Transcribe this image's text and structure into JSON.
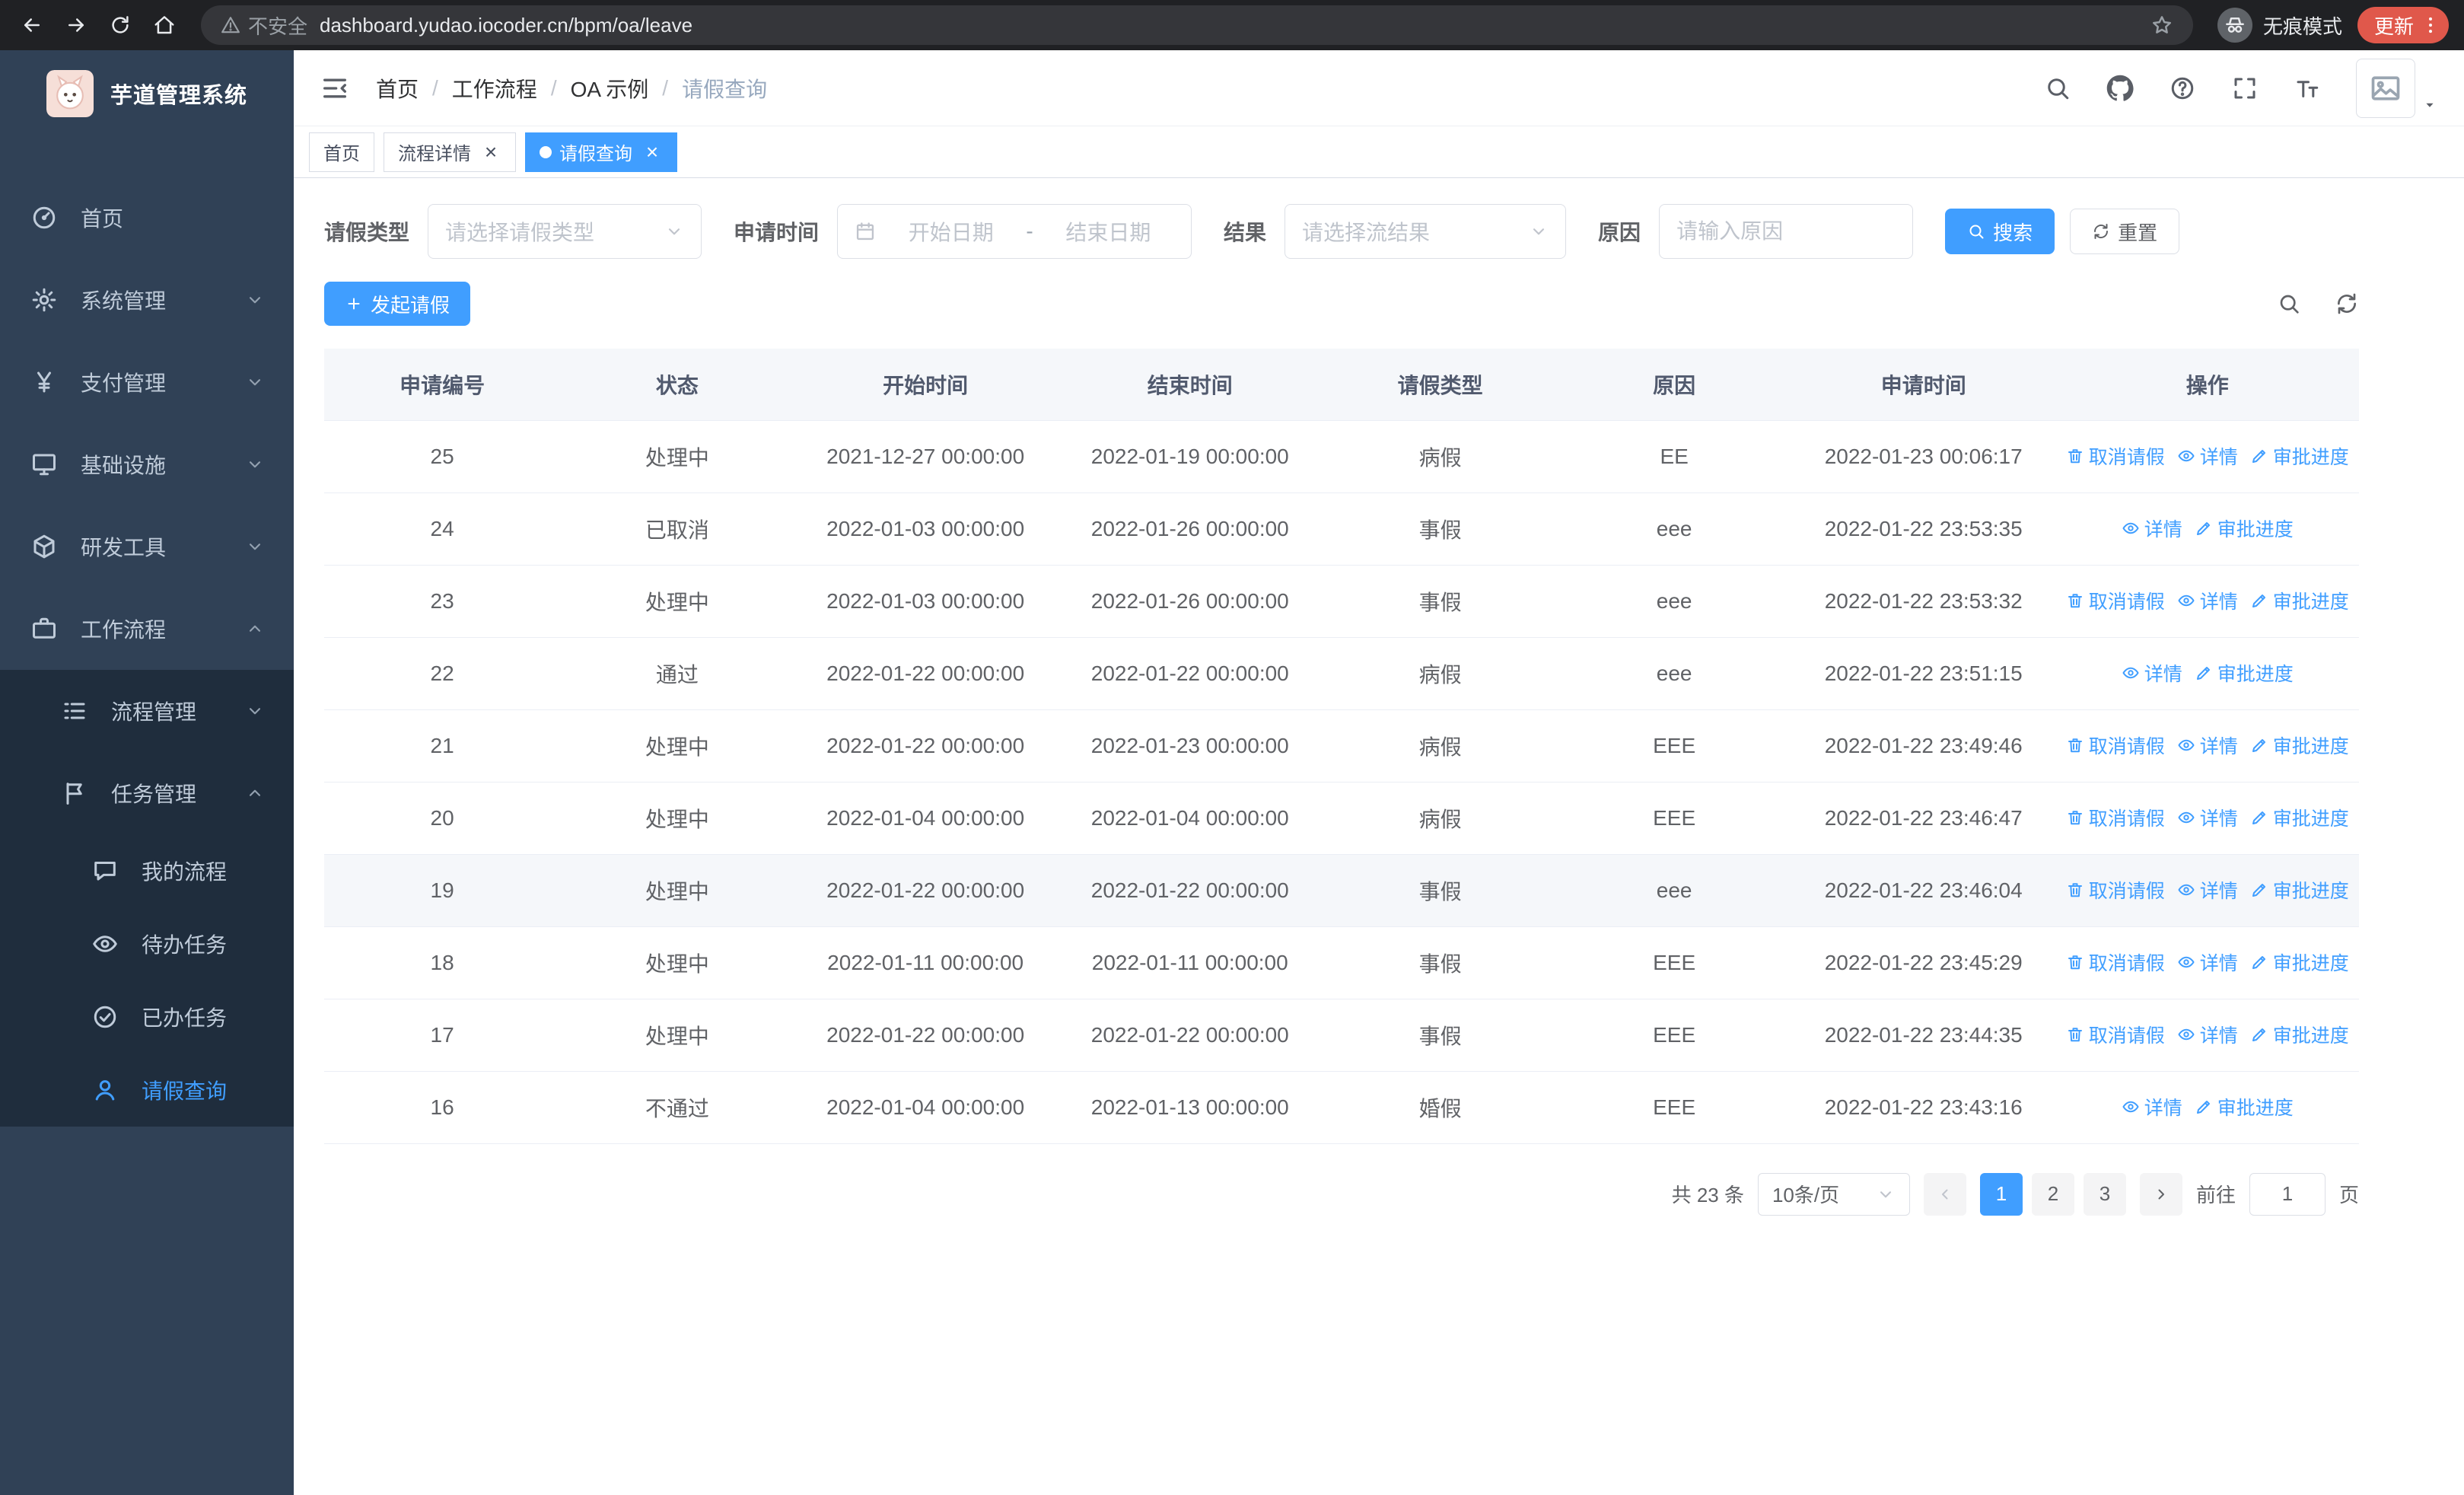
{
  "colors": {
    "accent": "#409eff",
    "sidebar_bg": "#304156",
    "submenu_bg": "#1f2d3d",
    "update_badge": "#e0584b"
  },
  "browser": {
    "security_label": "不安全",
    "url": "dashboard.yudao.iocoder.cn/bpm/oa/leave",
    "incognito_label": "无痕模式",
    "update_label": "更新"
  },
  "sidebar": {
    "logo_title": "芋道管理系统",
    "menu": [
      {
        "key": "home",
        "label": "首页",
        "icon": "dashboard"
      },
      {
        "key": "system",
        "label": "系统管理",
        "icon": "gear",
        "chevron": "down"
      },
      {
        "key": "payment",
        "label": "支付管理",
        "icon": "yen",
        "chevron": "down"
      },
      {
        "key": "infrastructure",
        "label": "基础设施",
        "icon": "infra",
        "chevron": "down"
      },
      {
        "key": "dev-tools",
        "label": "研发工具",
        "icon": "tools",
        "chevron": "down"
      },
      {
        "key": "workflow",
        "label": "工作流程",
        "icon": "workflow",
        "chevron": "up",
        "children": [
          {
            "key": "process-mgmt",
            "label": "流程管理",
            "icon": "list",
            "chevron": "down"
          },
          {
            "key": "task-mgmt",
            "label": "任务管理",
            "icon": "flag",
            "chevron": "up",
            "children": [
              {
                "key": "my-process",
                "label": "我的流程",
                "icon": "chat"
              },
              {
                "key": "todo-task",
                "label": "待办任务",
                "icon": "eye"
              },
              {
                "key": "done-task",
                "label": "已办任务",
                "icon": "check"
              },
              {
                "key": "leave-query",
                "label": "请假查询",
                "icon": "person",
                "active": true
              }
            ]
          }
        ]
      }
    ]
  },
  "header": {
    "breadcrumb": [
      "首页",
      "工作流程",
      "OA 示例",
      "请假查询"
    ]
  },
  "tabs": [
    {
      "key": "home",
      "label": "首页",
      "closable": false,
      "active": false
    },
    {
      "key": "process-detail",
      "label": "流程详情",
      "closable": true,
      "active": false
    },
    {
      "key": "leave-query",
      "label": "请假查询",
      "closable": true,
      "active": true
    }
  ],
  "filters": {
    "leave_type_label": "请假类型",
    "leave_type_placeholder": "请选择请假类型",
    "apply_time_label": "申请时间",
    "start_date_placeholder": "开始日期",
    "range_separator": "-",
    "end_date_placeholder": "结束日期",
    "result_label": "结果",
    "result_placeholder": "请选择流结果",
    "reason_label": "原因",
    "reason_placeholder": "请输入原因",
    "search_label": "搜索",
    "reset_label": "重置"
  },
  "toolbar": {
    "create_label": "发起请假"
  },
  "table": {
    "columns": [
      {
        "key": "apply-no",
        "label": "申请编号"
      },
      {
        "key": "status",
        "label": "状态"
      },
      {
        "key": "start-time",
        "label": "开始时间"
      },
      {
        "key": "end-time",
        "label": "结束时间"
      },
      {
        "key": "leave-type",
        "label": "请假类型"
      },
      {
        "key": "reason",
        "label": "原因"
      },
      {
        "key": "apply-time",
        "label": "申请时间"
      },
      {
        "key": "actions",
        "label": "操作"
      }
    ],
    "action_labels": {
      "cancel": "取消请假",
      "detail": "详情",
      "progress": "审批进度"
    },
    "rows": [
      {
        "id": "25",
        "status": "处理中",
        "start": "2021-12-27 00:00:00",
        "end": "2022-01-19 00:00:00",
        "type": "病假",
        "reason": "EE",
        "applied": "2022-01-23 00:06:17",
        "actions": [
          "cancel",
          "detail",
          "progress"
        ],
        "highlighted": false
      },
      {
        "id": "24",
        "status": "已取消",
        "start": "2022-01-03 00:00:00",
        "end": "2022-01-26 00:00:00",
        "type": "事假",
        "reason": "eee",
        "applied": "2022-01-22 23:53:35",
        "actions": [
          "detail",
          "progress"
        ],
        "highlighted": false
      },
      {
        "id": "23",
        "status": "处理中",
        "start": "2022-01-03 00:00:00",
        "end": "2022-01-26 00:00:00",
        "type": "事假",
        "reason": "eee",
        "applied": "2022-01-22 23:53:32",
        "actions": [
          "cancel",
          "detail",
          "progress"
        ],
        "highlighted": false
      },
      {
        "id": "22",
        "status": "通过",
        "start": "2022-01-22 00:00:00",
        "end": "2022-01-22 00:00:00",
        "type": "病假",
        "reason": "eee",
        "applied": "2022-01-22 23:51:15",
        "actions": [
          "detail",
          "progress"
        ],
        "highlighted": false
      },
      {
        "id": "21",
        "status": "处理中",
        "start": "2022-01-22 00:00:00",
        "end": "2022-01-23 00:00:00",
        "type": "病假",
        "reason": "EEE",
        "applied": "2022-01-22 23:49:46",
        "actions": [
          "cancel",
          "detail",
          "progress"
        ],
        "highlighted": false
      },
      {
        "id": "20",
        "status": "处理中",
        "start": "2022-01-04 00:00:00",
        "end": "2022-01-04 00:00:00",
        "type": "病假",
        "reason": "EEE",
        "applied": "2022-01-22 23:46:47",
        "actions": [
          "cancel",
          "detail",
          "progress"
        ],
        "highlighted": false
      },
      {
        "id": "19",
        "status": "处理中",
        "start": "2022-01-22 00:00:00",
        "end": "2022-01-22 00:00:00",
        "type": "事假",
        "reason": "eee",
        "applied": "2022-01-22 23:46:04",
        "actions": [
          "cancel",
          "detail",
          "progress"
        ],
        "highlighted": true
      },
      {
        "id": "18",
        "status": "处理中",
        "start": "2022-01-11 00:00:00",
        "end": "2022-01-11 00:00:00",
        "type": "事假",
        "reason": "EEE",
        "applied": "2022-01-22 23:45:29",
        "actions": [
          "cancel",
          "detail",
          "progress"
        ],
        "highlighted": false
      },
      {
        "id": "17",
        "status": "处理中",
        "start": "2022-01-22 00:00:00",
        "end": "2022-01-22 00:00:00",
        "type": "事假",
        "reason": "EEE",
        "applied": "2022-01-22 23:44:35",
        "actions": [
          "cancel",
          "detail",
          "progress"
        ],
        "highlighted": false
      },
      {
        "id": "16",
        "status": "不通过",
        "start": "2022-01-04 00:00:00",
        "end": "2022-01-13 00:00:00",
        "type": "婚假",
        "reason": "EEE",
        "applied": "2022-01-22 23:43:16",
        "actions": [
          "detail",
          "progress"
        ],
        "highlighted": false
      }
    ]
  },
  "pagination": {
    "total_label": "共 23 条",
    "page_size_label": "10条/页",
    "pages": [
      "1",
      "2",
      "3"
    ],
    "active_page": "1",
    "goto_label": "前往",
    "goto_value": "1",
    "page_unit_label": "页"
  }
}
